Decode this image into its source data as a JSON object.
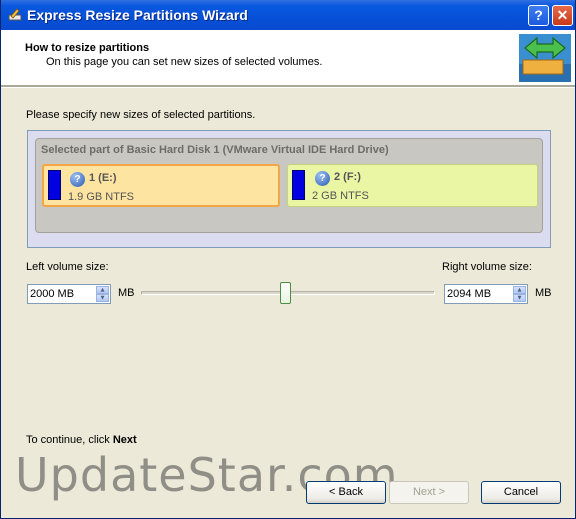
{
  "window": {
    "title": "Express Resize Partitions Wizard",
    "help_label": "?",
    "close_label": "✕"
  },
  "header": {
    "title": "How to resize partitions",
    "subtitle": "On this page you can set new sizes of selected volumes."
  },
  "main": {
    "intro": "Please specify new sizes of selected partitions.",
    "disk_title": "Selected part of Basic Hard Disk 1 (VMware Virtual IDE Hard Drive)",
    "partitions": [
      {
        "name": "1 (E:)",
        "info": "1.9 GB NTFS"
      },
      {
        "name": "2 (F:)",
        "info": "2 GB NTFS"
      }
    ],
    "left_label": "Left volume size:",
    "right_label": "Right volume size:",
    "left_value": "2000 MB",
    "right_value": "2094 MB",
    "unit": "MB",
    "slider_position_fraction": 0.49
  },
  "footer": {
    "continue_text": "To continue, click ",
    "continue_bold": "Next",
    "back_label": "< Back",
    "next_label": "Next >",
    "cancel_label": "Cancel",
    "watermark": "UpdateStar.com"
  },
  "colors": {
    "titlebar": "#0550d6",
    "partition1_fill": "#fde4a0",
    "partition2_fill": "#eaf6a3",
    "volume_bar": "#0000e0"
  }
}
